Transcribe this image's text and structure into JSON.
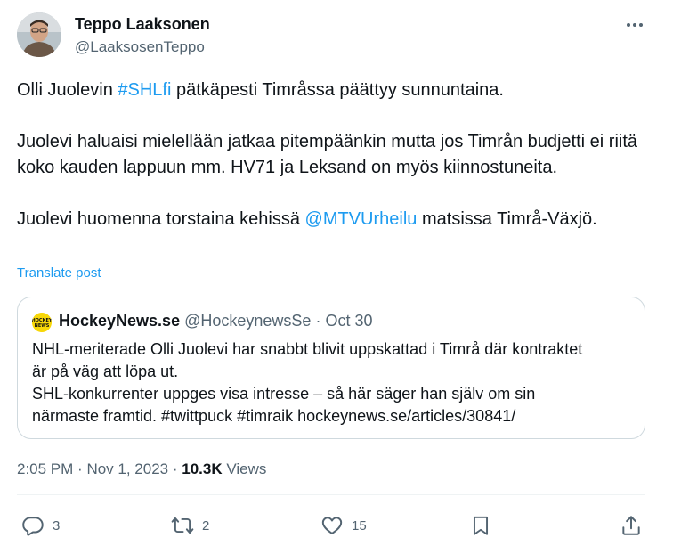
{
  "author": {
    "name": "Teppo Laaksonen",
    "handle": "@LaaksosenTeppo"
  },
  "post": {
    "paragraphs": [
      [
        {
          "text": "Olli Juolevin ",
          "link": false
        },
        {
          "text": "#SHLfi",
          "link": true
        },
        {
          "text": " pätkäpesti Timråssa päättyy sunnuntaina.",
          "link": false
        }
      ],
      [
        {
          "text": "Juolevi haluaisi mielellään jatkaa pitempäänkin mutta jos Timrån budjetti ei riitä koko kauden lappuun mm. HV71 ja Leksand on myös kiinnostuneita.",
          "link": false
        }
      ],
      [
        {
          "text": "Juolevi huomenna torstaina kehissä ",
          "link": false
        },
        {
          "text": "@MTVUrheilu",
          "link": true
        },
        {
          "text": " matsissa Timrå-Växjö.",
          "link": false
        }
      ]
    ],
    "translate_label": "Translate post",
    "time": "2:05 PM",
    "date": "Nov 1, 2023",
    "views": "10.3K",
    "views_label": "Views"
  },
  "quote": {
    "avatar_text": "HOCKEY NEWS",
    "name": "HockeyNews.se",
    "handle": "@HockeynewsSe",
    "date": "Oct 30",
    "lines": [
      "NHL-meriterade Olli Juolevi har snabbt blivit uppskattad i Timrå där kontraktet",
      "är på väg att löpa ut.",
      "SHL-konkurrenter uppges visa intresse – så här säger han själv om sin",
      "närmaste framtid. #twittpuck #timraik hockeynews.se/articles/30841/"
    ]
  },
  "actions": {
    "replies": "3",
    "reposts": "2",
    "likes": "15"
  },
  "icons": {
    "more": "more-icon",
    "reply": "reply-icon",
    "repost": "repost-icon",
    "like": "like-icon",
    "bookmark": "bookmark-icon",
    "share": "share-icon"
  },
  "colors": {
    "accent": "#1d9bf0",
    "text": "#0f1419",
    "muted": "#536471",
    "border": "#cfd9de"
  }
}
